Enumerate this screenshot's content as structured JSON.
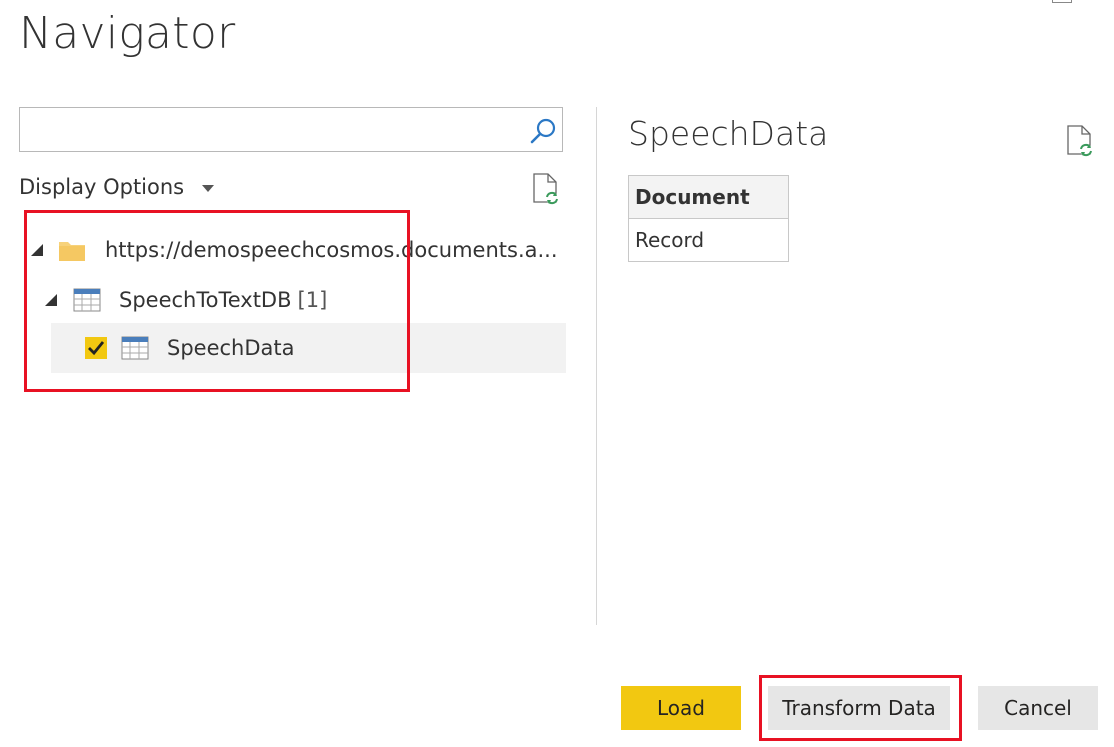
{
  "window": {
    "title": "Navigator"
  },
  "search": {
    "value": "",
    "placeholder": "",
    "icon": "search-icon"
  },
  "display_options": {
    "label": "Display Options",
    "icon": "chevron-down-icon"
  },
  "tree": {
    "server": {
      "label": "https://demospeechcosmos.documents.a...",
      "icon": "folder-icon",
      "expanded": true
    },
    "database": {
      "label": "SpeechToTextDB",
      "count": "[1]",
      "icon": "table-icon",
      "expanded": true
    },
    "table": {
      "label": "SpeechData",
      "icon": "table-icon",
      "checked": true
    }
  },
  "preview": {
    "title": "SpeechData",
    "columns": [
      "Document"
    ],
    "rows": [
      [
        "Record"
      ]
    ]
  },
  "buttons": {
    "load": "Load",
    "transform": "Transform Data",
    "cancel": "Cancel"
  },
  "colors": {
    "accent": "#f2c811",
    "highlight_box": "#e81123",
    "button_gray": "#e6e6e6"
  }
}
